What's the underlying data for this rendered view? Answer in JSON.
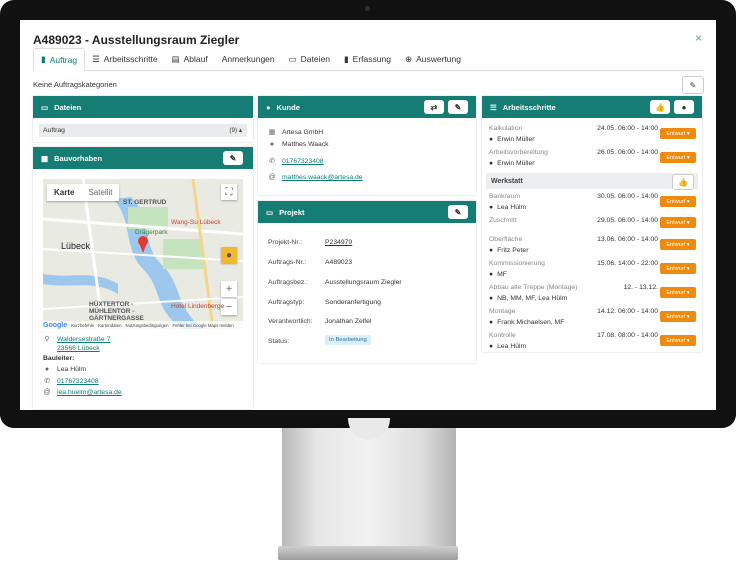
{
  "modal": {
    "title": "A489023 - Ausstellungsraum Ziegler",
    "close": "×"
  },
  "tabs": [
    {
      "label": "Auftrag",
      "icon": "▮"
    },
    {
      "label": "Arbeitsschritte",
      "icon": "☰"
    },
    {
      "label": "Ablauf",
      "icon": "▤"
    },
    {
      "label": "Anmerkungen",
      "icon": ""
    },
    {
      "label": "Dateien",
      "icon": "▭"
    },
    {
      "label": "Erfassung",
      "icon": "▮"
    },
    {
      "label": "Auswertung",
      "icon": "⊕"
    }
  ],
  "kategorie": "Keine Auftragskategorien",
  "dateien": {
    "title": "Dateien",
    "row_label": "Auftrag",
    "row_count": "(9) ▴"
  },
  "bauvorhaben": {
    "title": "Bauvorhaben",
    "map": {
      "tab_karte": "Karte",
      "tab_satellit": "Satellit",
      "labels": [
        "ST. GERTRUD",
        "Lübeck",
        "Wang-Su Lübeck",
        "Drägerpark",
        "HÜXTERTOR - MÜHLENTOR - GÄRTNERGASSE",
        "Hotel Lindenberge"
      ],
      "footer": [
        "Google",
        "Kurzbefehle",
        "Kartendaten",
        "Nutzungsbedingungen",
        "Fehler bei Google Maps melden"
      ]
    },
    "street": "Waldersestraße 7",
    "city": "23566 Lübeck",
    "bauleiter_label": "Bauleiter:",
    "person": "Lea Hülm",
    "phone": "01767323408",
    "email": "lea.huelm@artesa.de"
  },
  "kunde": {
    "title": "Kunde",
    "company": "Artesa GmbH",
    "person": "Matthes Waack",
    "phone": "01767323408",
    "email": "matthes.waack@artesa.de"
  },
  "projekt": {
    "title": "Projekt",
    "rows": [
      {
        "label": "Projekt-Nr.:",
        "value": "P234979"
      },
      {
        "label": "Auftrags-Nr.:",
        "value": "A489023"
      },
      {
        "label": "Auftragsbez.:",
        "value": "Ausstellungsraum Ziegler"
      },
      {
        "label": "Auftragstyp:",
        "value": "Sonderanfertigung"
      },
      {
        "label": "Verantwortlich:",
        "value": "Jonathan Zelfel"
      },
      {
        "label": "Status:",
        "value": "In Bearbeitung"
      }
    ]
  },
  "arbeitsschritte": {
    "title": "Arbeitsschritte",
    "werkstatt_label": "Werkstatt",
    "button_label": "Entwurf ▾",
    "steps": [
      {
        "name": "Kalkulation",
        "person": "Erwin Müller",
        "date": "24.05. 06:00 - 14:00"
      },
      {
        "name": "Arbeitsvorbereitung",
        "person": "Erwin Müller",
        "date": "26.05. 06:00 - 14:00"
      },
      {
        "name": "Bankraum",
        "person": "Lea Hülm",
        "date": "30.05. 06:00 - 14:00"
      },
      {
        "name": "Zuschnitt",
        "person": "",
        "date": "29.05. 06:00 - 14:00"
      },
      {
        "name": "Oberfläche",
        "person": "Fritz Peter",
        "date": "13.06. 06:00 - 14:00"
      },
      {
        "name": "Kommissionierung",
        "person": "MF",
        "date": "15.06. 14:00 - 22:00"
      },
      {
        "name": "Abbau alte Treppe (Montage)",
        "person": "NB, MM, MF, Lea Hülm",
        "date": "12. - 13.12."
      },
      {
        "name": "Montage",
        "person": "Frank Michaelsen, MF",
        "date": "14.12. 06:00 - 14:00"
      },
      {
        "name": "Kontrolle",
        "person": "Lea Hülm",
        "date": "17.08. 08:00 - 14:00"
      }
    ]
  }
}
